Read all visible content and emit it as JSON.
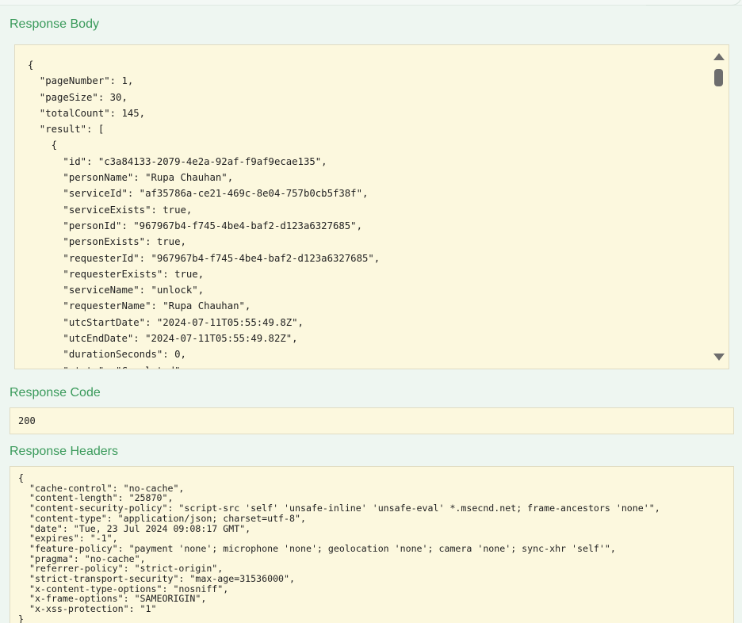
{
  "response_body": {
    "title": "Response Body",
    "lines": [
      "{",
      "  \"pageNumber\": 1,",
      "  \"pageSize\": 30,",
      "  \"totalCount\": 145,",
      "  \"result\": [",
      "    {",
      "      \"id\": \"c3a84133-2079-4e2a-92af-f9af9ecae135\",",
      "      \"personName\": \"Rupa Chauhan\",",
      "      \"serviceId\": \"af35786a-ce21-469c-8e04-757b0cb5f38f\",",
      "      \"serviceExists\": true,",
      "      \"personId\": \"967967b4-f745-4be4-baf2-d123a6327685\",",
      "      \"personExists\": true,",
      "      \"requesterId\": \"967967b4-f745-4be4-baf2-d123a6327685\",",
      "      \"requesterExists\": true,",
      "      \"serviceName\": \"unlock\",",
      "      \"requesterName\": \"Rupa Chauhan\",",
      "      \"utcStartDate\": \"2024-07-11T05:55:49.8Z\",",
      "      \"utcEndDate\": \"2024-07-11T05:55:49.82Z\",",
      "      \"durationSeconds\": 0,",
      "      \"state\": \"Completed\","
    ]
  },
  "response_code": {
    "title": "Response Code",
    "value": "200"
  },
  "response_headers": {
    "title": "Response Headers",
    "lines": [
      "{",
      "  \"cache-control\": \"no-cache\",",
      "  \"content-length\": \"25870\",",
      "  \"content-security-policy\": \"script-src 'self' 'unsafe-inline' 'unsafe-eval' *.msecnd.net; frame-ancestors 'none'\",",
      "  \"content-type\": \"application/json; charset=utf-8\",",
      "  \"date\": \"Tue, 23 Jul 2024 09:08:17 GMT\",",
      "  \"expires\": \"-1\",",
      "  \"feature-policy\": \"payment 'none'; microphone 'none'; geolocation 'none'; camera 'none'; sync-xhr 'self'\",",
      "  \"pragma\": \"no-cache\",",
      "  \"referrer-policy\": \"strict-origin\",",
      "  \"strict-transport-security\": \"max-age=31536000\",",
      "  \"x-content-type-options\": \"nosniff\",",
      "  \"x-frame-options\": \"SAMEORIGIN\",",
      "  \"x-xss-protection\": \"1\"",
      "}"
    ]
  },
  "icons": {
    "scroll_up": "triangle-up-icon",
    "scroll_down": "triangle-down-icon"
  },
  "colors": {
    "accent": "#3a9a5b",
    "panel_bg": "#fcf8de",
    "page_bg": "#eef6f1"
  }
}
